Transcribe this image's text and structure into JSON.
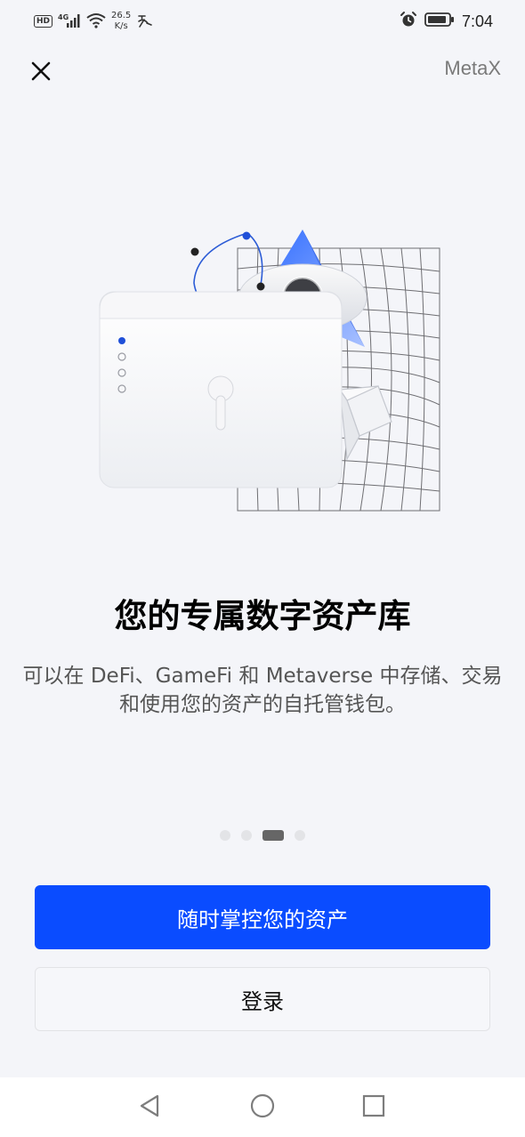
{
  "status_bar": {
    "hd_label": "HD",
    "network_label": "4G",
    "net_speed_value": "26.5",
    "net_speed_unit": "K/s",
    "time": "7:04"
  },
  "header": {
    "brand": "MetaX"
  },
  "onboarding": {
    "headline": "您的专属数字资产库",
    "subtitle": "可以在 DeFi、GameFi 和 Metaverse 中存储、交易和使用您的资产的自托管钱包。",
    "page_count": 4,
    "current_page": 3
  },
  "actions": {
    "primary_label": "随时掌控您的资产",
    "secondary_label": "登录"
  },
  "colors": {
    "accent": "#0a4cff",
    "background": "#f4f5f9"
  },
  "icons": {
    "close": "close-icon",
    "back": "back-triangle-icon",
    "home": "home-circle-icon",
    "recents": "recents-square-icon"
  }
}
